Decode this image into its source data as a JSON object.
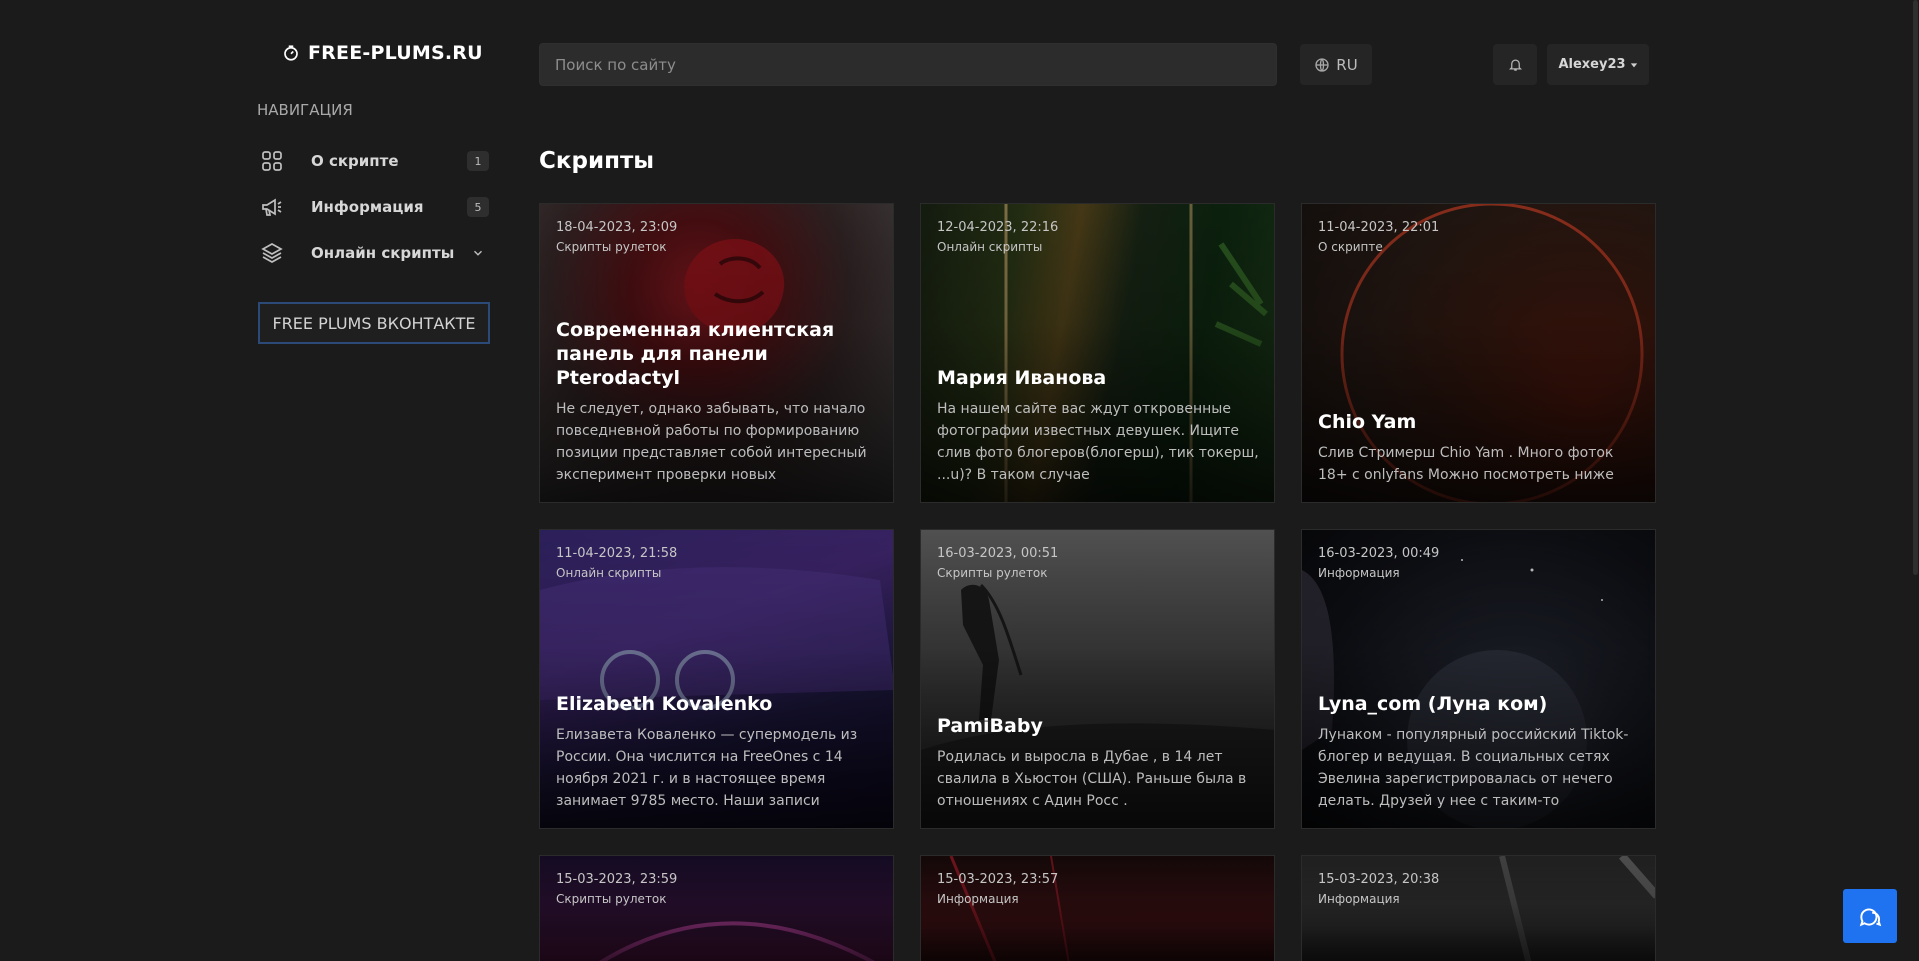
{
  "site": {
    "logo_text": "FREE-PLUMS.RU"
  },
  "sidebar": {
    "heading": "НАВИГАЦИЯ",
    "items": [
      {
        "label": "О скрипте",
        "badge": "1",
        "icon": "grid-icon"
      },
      {
        "label": "Информация",
        "badge": "5",
        "icon": "megaphone-icon"
      },
      {
        "label": "Онлайн скрипты",
        "icon": "layers-icon",
        "expandable": true
      }
    ],
    "vk_button": "FREE PLUMS ВКОНТАКТЕ"
  },
  "header": {
    "search_placeholder": "Поиск по сайту",
    "lang": "RU",
    "username": "Alexey23"
  },
  "main": {
    "title": "Скрипты",
    "cards": [
      {
        "date": "18-04-2023, 23:09",
        "category": "Скрипты рулеток",
        "title": "Современная клиентская панель для панели Pterodactyl",
        "desc": "Не следует, однако забывать, что начало повседневной работы по формированию позиции представляет собой интересный эксперимент проверки новых"
      },
      {
        "date": "12-04-2023, 22:16",
        "category": "Онлайн скрипты",
        "title": "Мария Иванова",
        "desc": "На нашем сайте вас ждут откровенные фотографии известных девушек. Ищите слив фото блогеров(блогерш), тик токерш, ...u)? В таком случае"
      },
      {
        "date": "11-04-2023, 22:01",
        "category": "О скрипте",
        "title": "Chio Yam",
        "desc": "Слив Стримерш Chio Yam . Много фоток 18+ с onlyfans Можно посмотреть ниже"
      },
      {
        "date": "11-04-2023, 21:58",
        "category": "Онлайн скрипты",
        "title": "Elizabeth Kovalenko",
        "desc": "Елизавета Коваленко — супермодель из России. Она числится на FreeOnes с 14 ноября 2021 г. и в настоящее время занимает 9785 место. Наши записи"
      },
      {
        "date": "16-03-2023, 00:51",
        "category": "Скрипты рулеток",
        "title": "PamiBaby",
        "desc": "Родилась и выросла в Дубае , в 14 лет свалила в Хьюстон (США). Раньше была в отношениях с Адин Росс ."
      },
      {
        "date": "16-03-2023, 00:49",
        "category": "Информация",
        "title": "Lyna_com (Луна ком)",
        "desc": "Лунаком - популярный российский Tiktok-блогер и ведущая. В социальных сетях Эвелина зарегистрировалась от нечего делать. Друзей у нее с таким-то"
      },
      {
        "date": "15-03-2023, 23:59",
        "category": "Скрипты рулеток"
      },
      {
        "date": "15-03-2023, 23:57",
        "category": "Информация"
      },
      {
        "date": "15-03-2023, 20:38",
        "category": "Информация"
      }
    ]
  },
  "colors": {
    "accent": "#1f72f0",
    "background": "#1b1b1b",
    "vk_border": "#2c4a78"
  }
}
